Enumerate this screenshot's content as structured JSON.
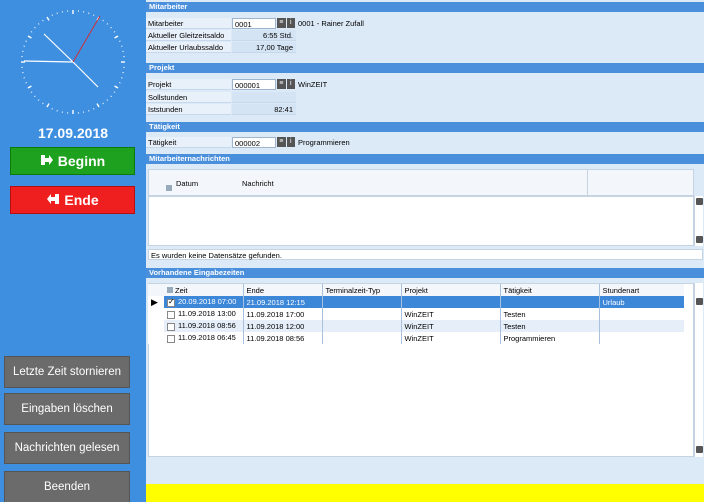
{
  "left": {
    "date": "17.09.2018",
    "beginn_label": "Beginn",
    "ende_label": "Ende",
    "storno_label": "Letzte Zeit stornieren",
    "loeschen_label": "Eingaben löschen",
    "gelesen_label": "Nachrichten gelesen",
    "beenden_label": "Beenden",
    "beginn_color": "#1ea11e",
    "ende_color": "#f01f1f"
  },
  "mitarbeiter": {
    "section": "Mitarbeiter",
    "label": "Mitarbeiter",
    "number": "0001",
    "name": "0001 - Rainer Zufall",
    "gleitzeit_label": "Aktueller Gleitzeitsaldo",
    "gleitzeit_value": "6:55 Std.",
    "urlaub_label": "Aktueller Urlaubssaldo",
    "urlaub_value": "17,00 Tage"
  },
  "projekt": {
    "section": "Projekt",
    "label": "Projekt",
    "number": "000001",
    "name": "WinZEIT",
    "soll_label": "Sollstunden",
    "soll_value": "",
    "ist_label": "Iststunden",
    "ist_value": "82:41"
  },
  "taetigkeit": {
    "section": "Tätigkeit",
    "label": "Tätigkeit",
    "number": "000002",
    "name": "Programmieren"
  },
  "nachrichten": {
    "section": "Mitarbeiternachrichten",
    "col_datum": "Datum",
    "col_nachricht": "Nachricht",
    "empty_msg": "Es wurden keine Datensätze gefunden."
  },
  "eingabezeiten": {
    "section": "Vorhandene Eingabezeiten",
    "columns": [
      "Zeit",
      "Ende",
      "Terminalzeit-Typ",
      "Projekt",
      "Tätigkeit",
      "Stundenart"
    ],
    "rows": [
      {
        "zeit": "20.09.2018 07:00",
        "ende": "21.09.2018 12:15",
        "typ": "",
        "projekt": "",
        "taetigkeit": "",
        "stundenart": "Urlaub"
      },
      {
        "zeit": "11.09.2018 13:00",
        "ende": "11.09.2018 17:00",
        "typ": "",
        "projekt": "WinZEIT",
        "taetigkeit": "Testen",
        "stundenart": ""
      },
      {
        "zeit": "11.09.2018 08:56",
        "ende": "11.09.2018 12:00",
        "typ": "",
        "projekt": "WinZEIT",
        "taetigkeit": "Testen",
        "stundenart": ""
      },
      {
        "zeit": "11.09.2018 06:45",
        "ende": "11.09.2018 08:56",
        "typ": "",
        "projekt": "WinZEIT",
        "taetigkeit": "Programmieren",
        "stundenart": ""
      }
    ],
    "selected_row": 0,
    "selection_color": "#3d87d9"
  },
  "icons": {
    "dropdown": "list-icon",
    "info": "info-icon"
  }
}
